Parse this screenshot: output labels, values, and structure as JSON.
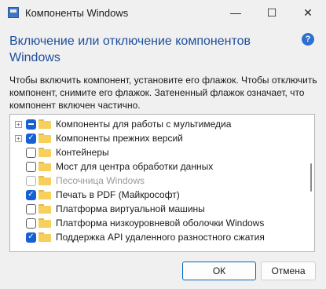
{
  "window": {
    "title": "Компоненты Windows",
    "minimize_glyph": "—",
    "maximize_glyph": "☐",
    "close_glyph": "✕"
  },
  "heading": "Включение или отключение компонентов Windows",
  "help_glyph": "?",
  "description": "Чтобы включить компонент, установите его флажок. Чтобы отключить компонент, снимите его флажок. Затененный флажок означает, что компонент включен частично.",
  "features": [
    {
      "label": "Компоненты для работы с мультимедиа",
      "state": "partial",
      "expandable": true,
      "disabled": false
    },
    {
      "label": "Компоненты прежних версий",
      "state": "checked",
      "expandable": true,
      "disabled": false
    },
    {
      "label": "Контейнеры",
      "state": "unchecked",
      "expandable": false,
      "disabled": false
    },
    {
      "label": "Мост для центра обработки данных",
      "state": "unchecked",
      "expandable": false,
      "disabled": false
    },
    {
      "label": "Песочница Windows",
      "state": "unchecked",
      "expandable": false,
      "disabled": true
    },
    {
      "label": "Печать в PDF (Майкрософт)",
      "state": "checked",
      "expandable": false,
      "disabled": false
    },
    {
      "label": "Платформа виртуальной машины",
      "state": "unchecked",
      "expandable": false,
      "disabled": false
    },
    {
      "label": "Платформа низкоуровневой оболочки Windows",
      "state": "unchecked",
      "expandable": false,
      "disabled": false
    },
    {
      "label": "Поддержка API удаленного разностного сжатия",
      "state": "checked",
      "expandable": false,
      "disabled": false
    }
  ],
  "buttons": {
    "ok": "ОК",
    "cancel": "Отмена"
  },
  "colors": {
    "heading": "#1f4e9c",
    "checkbox_accent": "#1660d6",
    "folder": "#f6cf5c"
  }
}
